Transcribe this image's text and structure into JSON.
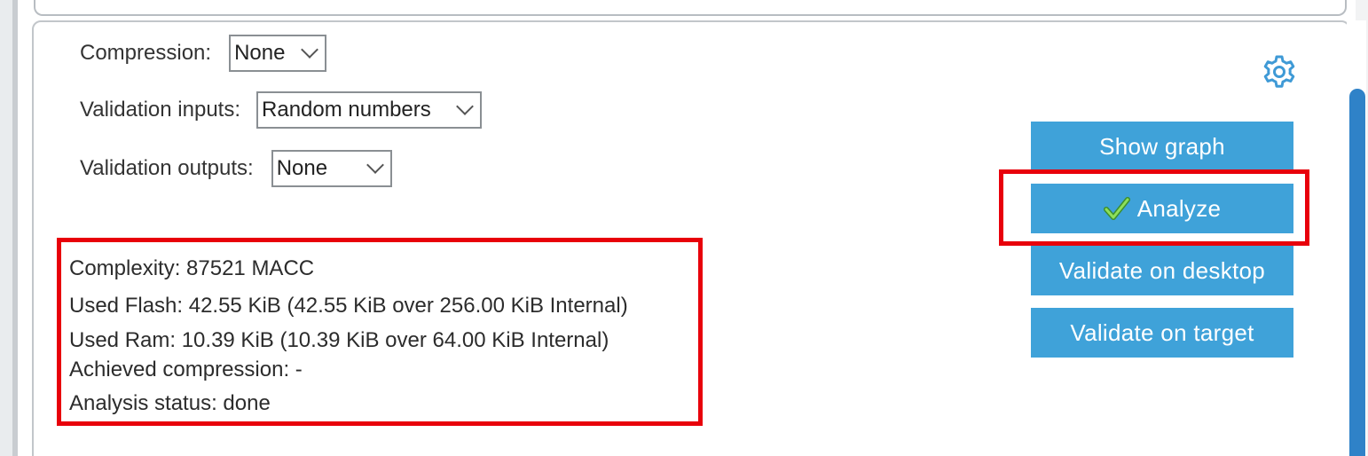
{
  "form": {
    "compression": {
      "label": "Compression:",
      "value": "None"
    },
    "validation_inputs": {
      "label": "Validation inputs:",
      "value": "Random numbers"
    },
    "validation_outputs": {
      "label": "Validation outputs:",
      "value": "None"
    }
  },
  "buttons": {
    "show_graph": "Show graph",
    "analyze": "Analyze",
    "validate_desktop": "Validate on desktop",
    "validate_target": "Validate on target"
  },
  "info": {
    "complexity": "Complexity:  87521 MACC",
    "used_flash": "Used Flash: 42.55 KiB (42.55 KiB over 256.00 KiB Internal)",
    "used_ram": "Used Ram: 10.39 KiB (10.39 KiB over 64.00 KiB Internal)",
    "achieved_compression": "Achieved compression: -",
    "analysis_status": "Analysis status: done"
  },
  "icons": {
    "settings": "gear-icon",
    "analyze_status": "check-icon",
    "dropdown": "chevron-down-icon"
  },
  "colors": {
    "button_bg": "#3fa2d9",
    "highlight": "#e8000b",
    "gear": "#3f9ad6",
    "scroll_thumb": "#2f82c8",
    "check": "#5cb85c"
  }
}
